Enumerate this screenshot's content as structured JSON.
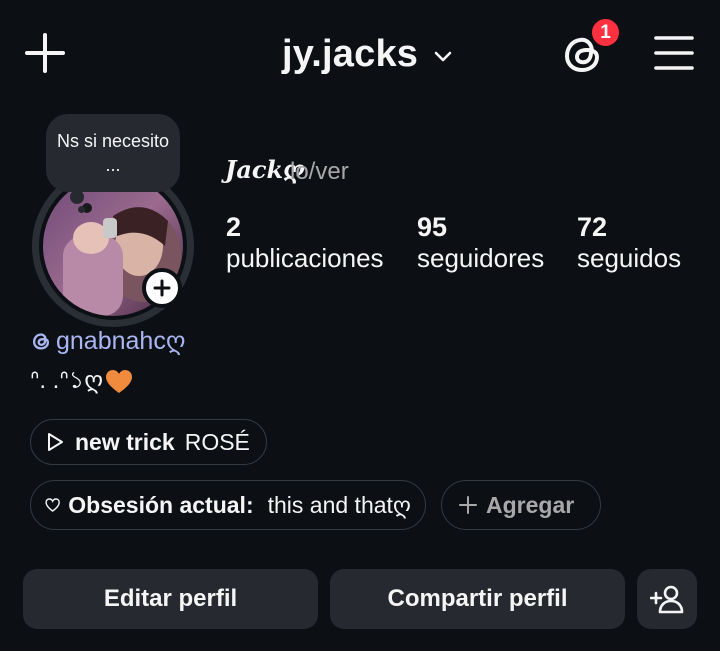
{
  "header": {
    "username": "jy.jacks",
    "notification_count": "1"
  },
  "profile": {
    "note": "Ns si necesito ...",
    "display_name": "Jackღ",
    "pronouns": "lo/ver",
    "stats": [
      {
        "value": "2",
        "label": "publicaciones"
      },
      {
        "value": "95",
        "label": "seguidores"
      },
      {
        "value": "72",
        "label": "seguidos"
      }
    ],
    "threads_handle": "gnabnahcღ",
    "bio": "ᐢ. .ᐢ১ღ"
  },
  "chips": {
    "music_title": "new trick",
    "music_artist": "ROSÉ",
    "obsession_label": "Obsesión actual:",
    "obsession_value": "this and thatღ",
    "add_label": "Agregar"
  },
  "actions": {
    "edit_label": "Editar perfil",
    "share_label": "Compartir perfil"
  },
  "colors": {
    "background": "#0c1014",
    "button": "#262a30",
    "badge": "#ff3040",
    "threads_handle": "#aab6f2",
    "heart": "#f08a3c"
  },
  "icons": [
    "plus-icon",
    "chevron-down-icon",
    "threads-icon",
    "menu-icon",
    "add-story-icon",
    "play-icon",
    "heart-icon",
    "add-user-icon"
  ]
}
